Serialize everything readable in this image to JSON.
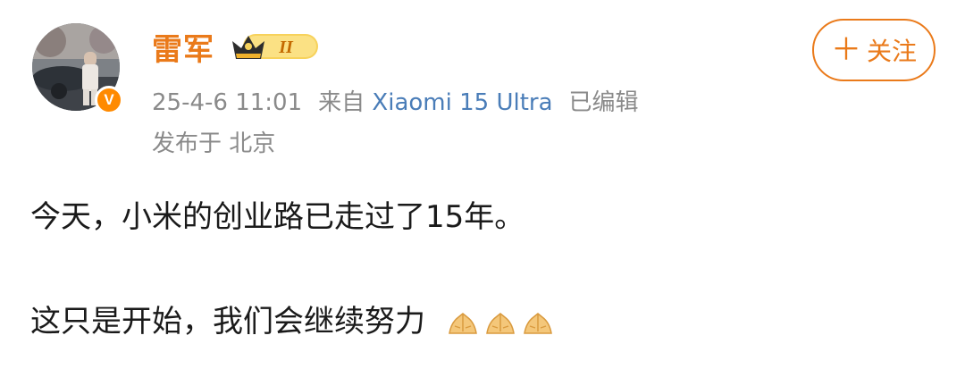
{
  "post": {
    "author": {
      "name": "雷军",
      "vip_level": "II",
      "verified_mark": "V"
    },
    "meta": {
      "timestamp": "25-4-6 11:01",
      "source_prefix": "来自",
      "device": "Xiaomi 15 Ultra",
      "edited": "已编辑",
      "location": "发布于 北京"
    },
    "follow_button": {
      "icon": "plus-icon",
      "label": "关注"
    },
    "body": {
      "line1": "今天，小米的创业路已走过了15年。",
      "line2": "这只是开始，我们会继续努力",
      "emoji": [
        "pinched-hands-emoji",
        "pinched-hands-emoji",
        "pinched-hands-emoji"
      ]
    }
  },
  "colors": {
    "accent": "#ea7a1a",
    "meta_text": "#8a8a8a",
    "device_link": "#4a7db8",
    "body_text": "#1a1a1a",
    "verified_badge": "#ff8a00"
  }
}
